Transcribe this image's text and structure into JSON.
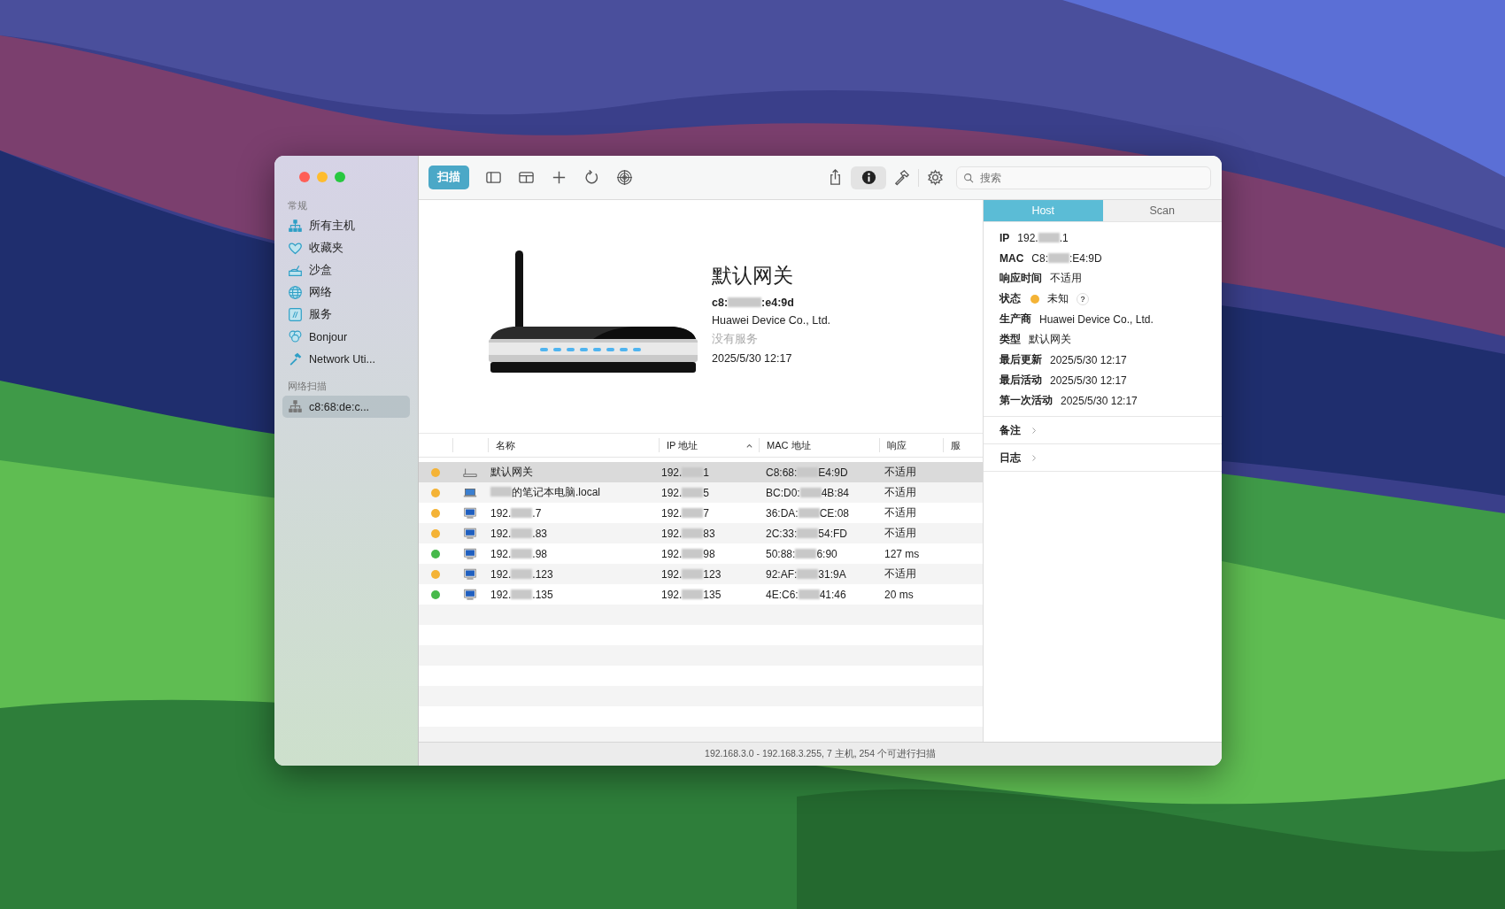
{
  "toolbar": {
    "scan_button": "扫描",
    "info_selected": true,
    "search": {
      "placeholder": "搜索"
    }
  },
  "sidebar": {
    "sections": [
      {
        "heading": "常规",
        "items": [
          {
            "label": "所有主机",
            "selected": false
          },
          {
            "label": "收藏夹",
            "selected": false
          },
          {
            "label": "沙盒",
            "selected": false
          },
          {
            "label": "网络",
            "selected": false
          },
          {
            "label": "服务",
            "selected": false
          },
          {
            "label": "Bonjour",
            "selected": false
          },
          {
            "label": "Network Uti...",
            "selected": false
          }
        ]
      },
      {
        "heading": "网络扫描",
        "items": [
          {
            "label": "c8:68:de:c...",
            "selected": true
          }
        ]
      }
    ]
  },
  "detail": {
    "title": "默认网关",
    "mac": {
      "pre": "c8:",
      "post": ":e4:9d"
    },
    "vendor": "Huawei Device Co., Ltd.",
    "services": "没有服务",
    "date": "2025/5/30 12:17"
  },
  "table": {
    "columns": [
      {
        "label": "名称",
        "sorted": false
      },
      {
        "label": "IP 地址",
        "sorted": true
      },
      {
        "label": "MAC 地址",
        "sorted": false
      },
      {
        "label": "响应",
        "sorted": false
      },
      {
        "label": "服",
        "sorted": false
      }
    ],
    "rows": [
      {
        "color": "#f4b336",
        "kind": "router",
        "selected": true,
        "name": "默认网关",
        "ip": {
          "pre": "192.",
          "post": "1"
        },
        "mac": {
          "pre": "C8:68:",
          "post": "E4:9D"
        },
        "response": "不适用"
      },
      {
        "color": "#f4b336",
        "kind": "laptop",
        "selected": false,
        "name": {
          "post": "的笔记本电脑.local"
        },
        "ip": {
          "pre": "192.",
          "post": "5"
        },
        "mac": {
          "pre": "BC:D0:",
          "post": "4B:84"
        },
        "response": "不适用"
      },
      {
        "color": "#f4b336",
        "kind": "desktop",
        "selected": false,
        "name": {
          "pre": "192.",
          "post": ".7"
        },
        "ip": {
          "pre": "192.",
          "post": "7"
        },
        "mac": {
          "pre": "36:DA:",
          "post": "CE:08"
        },
        "response": "不适用"
      },
      {
        "color": "#f4b336",
        "kind": "desktop",
        "selected": false,
        "name": {
          "pre": "192.",
          "post": ".83"
        },
        "ip": {
          "pre": "192.",
          "post": "83"
        },
        "mac": {
          "pre": "2C:33:",
          "post": "54:FD"
        },
        "response": "不适用"
      },
      {
        "color": "#47b94b",
        "kind": "desktop",
        "selected": false,
        "name": {
          "pre": "192.",
          "post": ".98"
        },
        "ip": {
          "pre": "192.",
          "post": "98"
        },
        "mac": {
          "pre": "50:88:",
          "post": "6:90"
        },
        "response": "127 ms"
      },
      {
        "color": "#f4b336",
        "kind": "desktop",
        "selected": false,
        "name": {
          "pre": "192.",
          "post": ".123"
        },
        "ip": {
          "pre": "192.",
          "post": "123"
        },
        "mac": {
          "pre": "92:AF:",
          "post": "31:9A"
        },
        "response": "不适用"
      },
      {
        "color": "#47b94b",
        "kind": "desktop",
        "selected": false,
        "name": {
          "pre": "192.",
          "post": ".135"
        },
        "ip": {
          "pre": "192.",
          "post": "135"
        },
        "mac": {
          "pre": "4E:C6:",
          "post": "41:46"
        },
        "response": "20 ms"
      }
    ]
  },
  "inspector": {
    "tabs": [
      {
        "label": "Host",
        "selected": true
      },
      {
        "label": "Scan",
        "selected": false
      }
    ],
    "fields": [
      {
        "kind": "text",
        "label": "IP",
        "value": {
          "pre": "192.",
          "post": ".1"
        }
      },
      {
        "kind": "text",
        "label": "MAC",
        "value": {
          "pre": "C8:",
          "post": ":E4:9D"
        }
      },
      {
        "kind": "text",
        "label": "响应时间",
        "value": "不适用"
      },
      {
        "kind": "status",
        "label": "状态",
        "color": "#f4b336",
        "value": "未知",
        "help": "?"
      },
      {
        "kind": "text",
        "label": "生产商",
        "value": "Huawei Device Co., Ltd."
      },
      {
        "kind": "text",
        "label": "类型",
        "value": "默认网关"
      },
      {
        "kind": "text",
        "label": "最后更新",
        "value": "2025/5/30 12:17"
      },
      {
        "kind": "text",
        "label": "最后活动",
        "value": "2025/5/30 12:17"
      },
      {
        "kind": "text",
        "label": "第一次活动",
        "value": "2025/5/30 12:17"
      }
    ],
    "sections": [
      {
        "label": "备注"
      },
      {
        "label": "日志"
      }
    ]
  },
  "status_bar": "192.168.3.0 - 192.168.3.255, 7 主机, 254 个可进行扫描"
}
